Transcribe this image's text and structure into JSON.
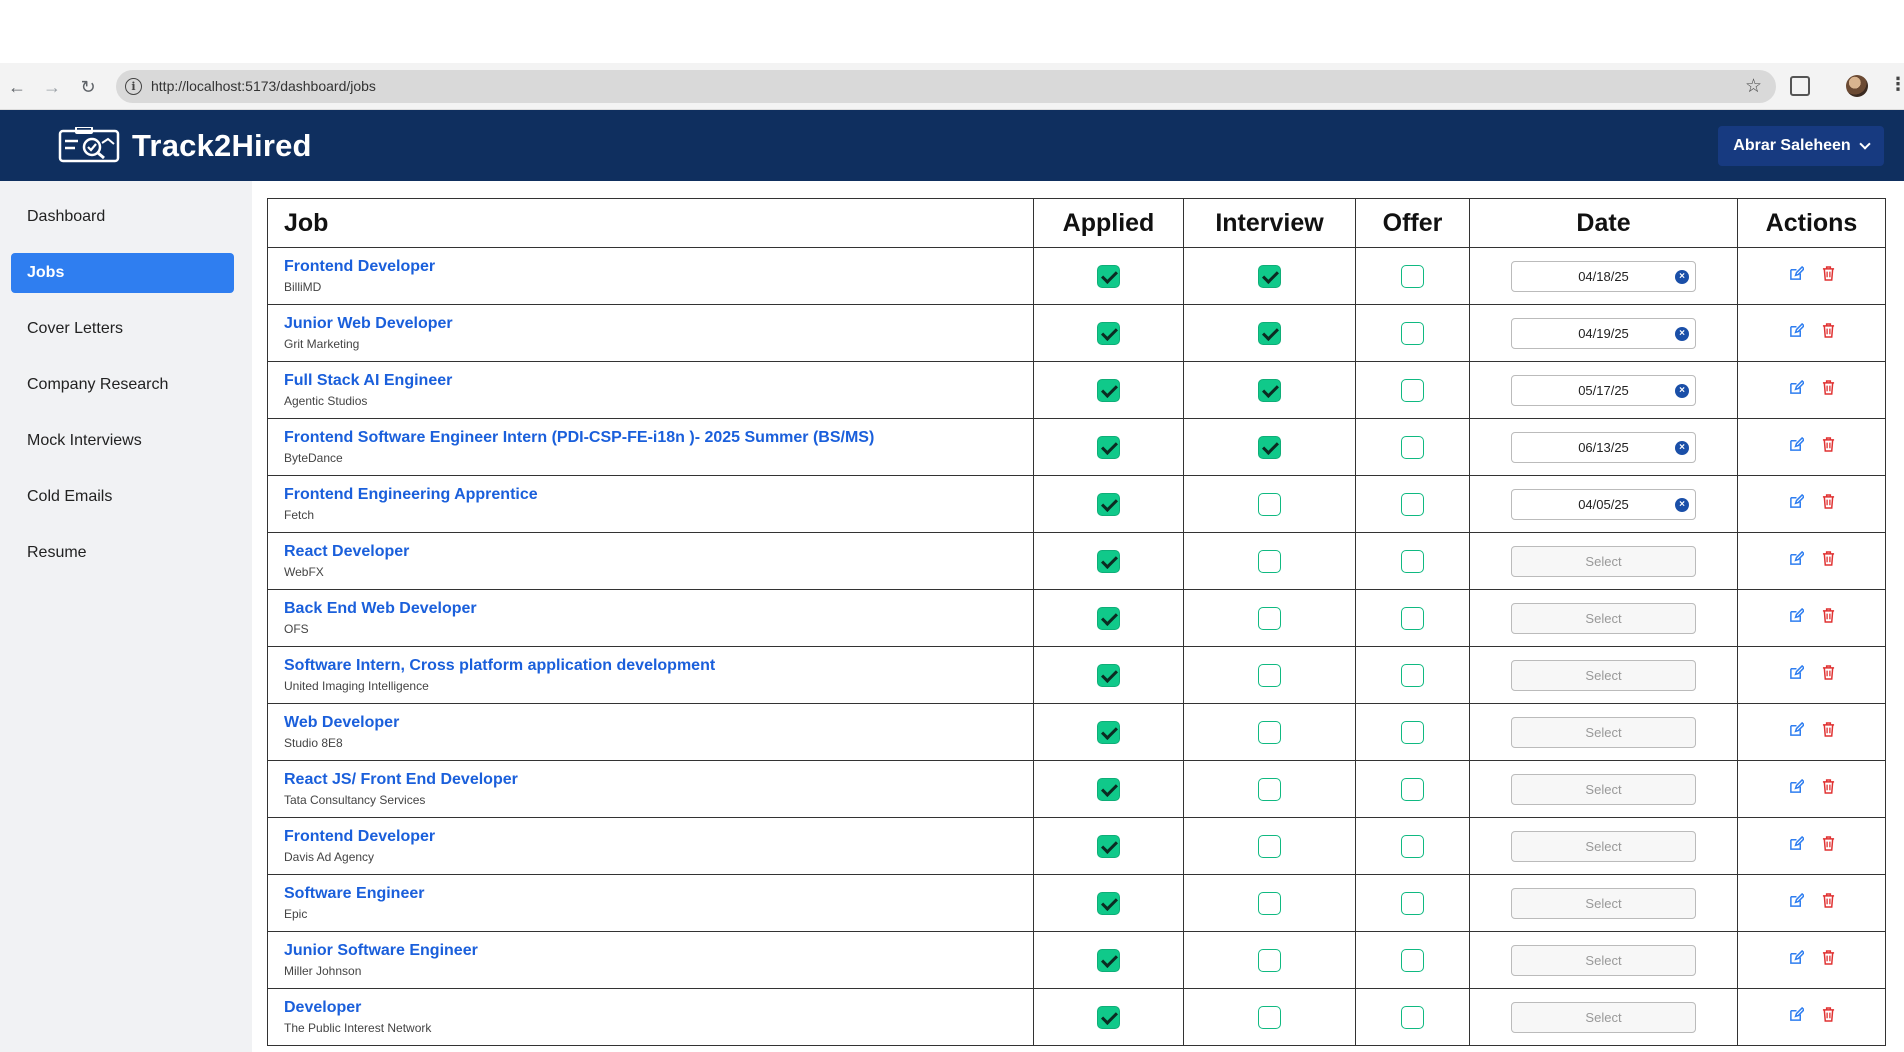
{
  "browser": {
    "url": "http://localhost:5173/dashboard/jobs"
  },
  "app": {
    "brand": "Track2Hired",
    "user_name": "Abrar Saleheen"
  },
  "sidebar": {
    "items": [
      {
        "label": "Dashboard",
        "active": false
      },
      {
        "label": "Jobs",
        "active": true
      },
      {
        "label": "Cover Letters",
        "active": false
      },
      {
        "label": "Company Research",
        "active": false
      },
      {
        "label": "Mock Interviews",
        "active": false
      },
      {
        "label": "Cold Emails",
        "active": false
      },
      {
        "label": "Resume",
        "active": false
      }
    ]
  },
  "table": {
    "headers": {
      "job": "Job",
      "applied": "Applied",
      "interview": "Interview",
      "offer": "Offer",
      "date": "Date",
      "actions": "Actions"
    },
    "date_placeholder": "Select",
    "rows": [
      {
        "title": "Frontend Developer",
        "company": "BilliMD",
        "applied": true,
        "interview": true,
        "offer": false,
        "date": "04/18/25"
      },
      {
        "title": "Junior Web Developer",
        "company": "Grit Marketing",
        "applied": true,
        "interview": true,
        "offer": false,
        "date": "04/19/25"
      },
      {
        "title": "Full Stack AI Engineer",
        "company": "Agentic Studios",
        "applied": true,
        "interview": true,
        "offer": false,
        "date": "05/17/25"
      },
      {
        "title": "Frontend Software Engineer Intern (PDI-CSP-FE-i18n )- 2025 Summer (BS/MS)",
        "company": "ByteDance",
        "applied": true,
        "interview": true,
        "offer": false,
        "date": "06/13/25"
      },
      {
        "title": "Frontend Engineering Apprentice",
        "company": "Fetch",
        "applied": true,
        "interview": false,
        "offer": false,
        "date": "04/05/25"
      },
      {
        "title": "React Developer",
        "company": "WebFX",
        "applied": true,
        "interview": false,
        "offer": false,
        "date": ""
      },
      {
        "title": "Back End Web Developer",
        "company": "OFS",
        "applied": true,
        "interview": false,
        "offer": false,
        "date": ""
      },
      {
        "title": "Software Intern, Cross platform application development",
        "company": "United Imaging Intelligence",
        "applied": true,
        "interview": false,
        "offer": false,
        "date": ""
      },
      {
        "title": "Web Developer",
        "company": "Studio 8E8",
        "applied": true,
        "interview": false,
        "offer": false,
        "date": ""
      },
      {
        "title": "React JS/ Front End Developer",
        "company": "Tata Consultancy Services",
        "applied": true,
        "interview": false,
        "offer": false,
        "date": ""
      },
      {
        "title": "Frontend Developer",
        "company": "Davis Ad Agency",
        "applied": true,
        "interview": false,
        "offer": false,
        "date": ""
      },
      {
        "title": "Software Engineer",
        "company": "Epic",
        "applied": true,
        "interview": false,
        "offer": false,
        "date": ""
      },
      {
        "title": "Junior Software Engineer",
        "company": "Miller Johnson",
        "applied": true,
        "interview": false,
        "offer": false,
        "date": ""
      },
      {
        "title": "Developer",
        "company": "The Public Interest Network",
        "applied": true,
        "interview": false,
        "offer": false,
        "date": ""
      }
    ]
  },
  "colors": {
    "appbar": "#0f2f5f",
    "accent": "#2f7ef0",
    "checkbox": "#10c98a",
    "link": "#1a5fdb",
    "delete": "#e03131"
  }
}
